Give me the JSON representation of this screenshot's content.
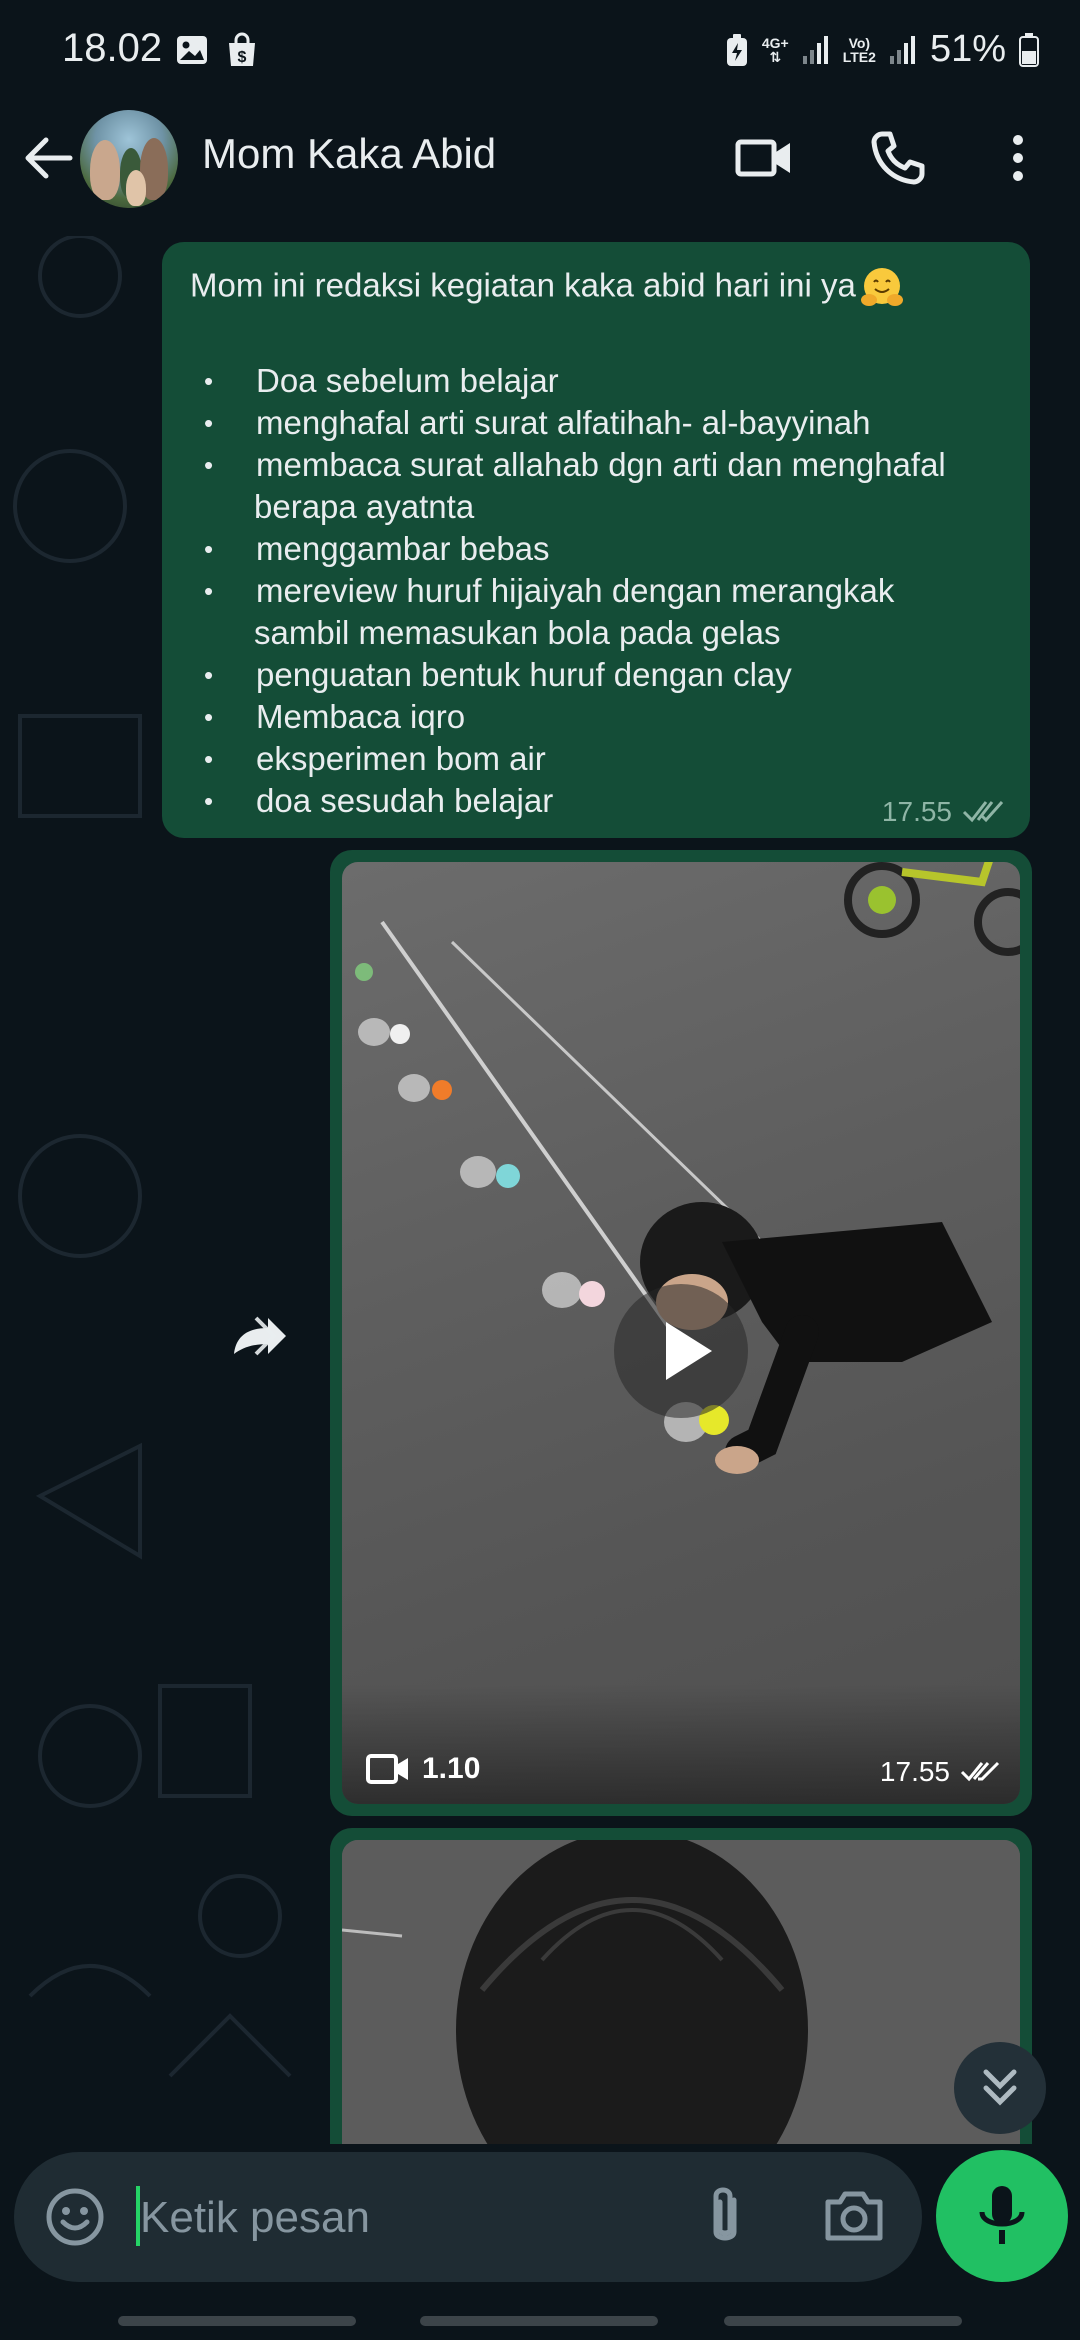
{
  "status_bar": {
    "time": "18.02",
    "network_4g": "4G+",
    "volte_top": "Vo)",
    "volte_bottom": "LTE2",
    "battery": "51%"
  },
  "header": {
    "contact_name": "Mom Kaka Abid"
  },
  "messages": {
    "text_message": {
      "title": "Mom ini redaksi kegiatan kaka abid hari ini ya",
      "emoji": "hugging-face-emoji",
      "items": [
        "Doa sebelum belajar",
        "menghafal arti surat alfatihah- al-bayyinah",
        "membaca surat allahab dgn arti dan menghafal",
        "berapa ayatnta",
        "menggambar bebas",
        "mereview huruf hijaiyah dengan merangkak",
        "sambil memasukan bola pada gelas",
        "penguatan bentuk huruf dengan clay",
        "Membaca iqro",
        "eksperimen bom air",
        "doa sesudah belajar"
      ],
      "time": "17.55",
      "status": "read-double-check"
    },
    "video_message": {
      "duration": "1.10",
      "time": "17.55",
      "status": "read-double-check"
    }
  },
  "input": {
    "placeholder": "Ketik pesan"
  },
  "colors": {
    "background": "#0b141a",
    "outgoing_bubble": "#144d37",
    "input_bar": "#1f2c33",
    "mic_button": "#21c063",
    "cursor": "#25d366"
  }
}
